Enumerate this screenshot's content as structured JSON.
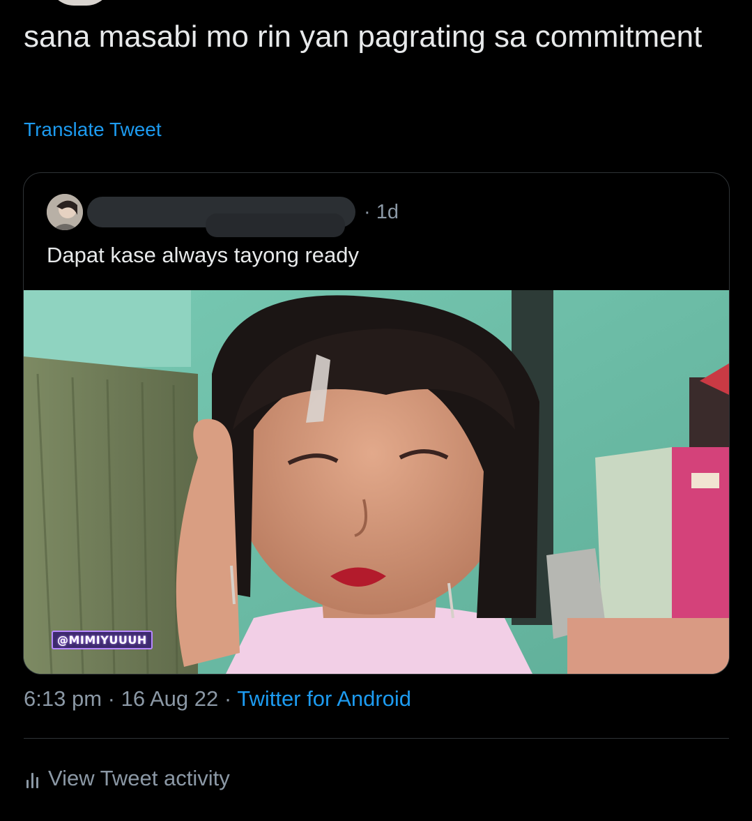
{
  "tweet": {
    "text": "sana masabi mo rin yan pagrating sa commitment",
    "translate_label": "Translate Tweet"
  },
  "quoted_tweet": {
    "time": "· 1d",
    "text": "Dapat kase always tayong ready",
    "watermark": "@MIMIYUUUH"
  },
  "meta": {
    "time": "6:13 pm",
    "sep1": " · ",
    "date": "16 Aug 22",
    "sep2": " · ",
    "source": "Twitter for Android"
  },
  "activity": {
    "label": "View Tweet activity",
    "icon": "analytics-bars-icon"
  },
  "colors": {
    "background": "#000000",
    "text": "#e7e9ea",
    "secondary_text": "#8b98a5",
    "link": "#1d9bf0",
    "border": "#2f3336"
  }
}
